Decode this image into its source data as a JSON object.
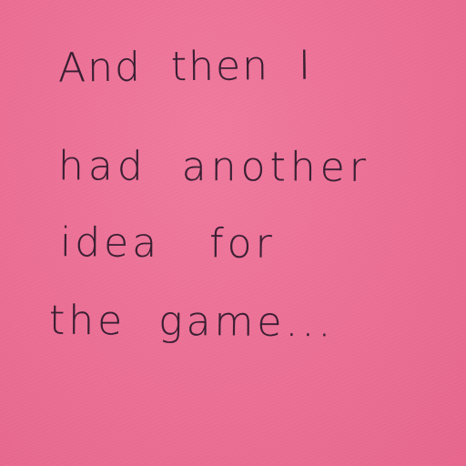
{
  "note": {
    "background_color": "#ec6f95",
    "ink_color": "#3a1f33",
    "lines": [
      "And  then  I",
      "had  another",
      "idea   for",
      "the  game..."
    ]
  }
}
